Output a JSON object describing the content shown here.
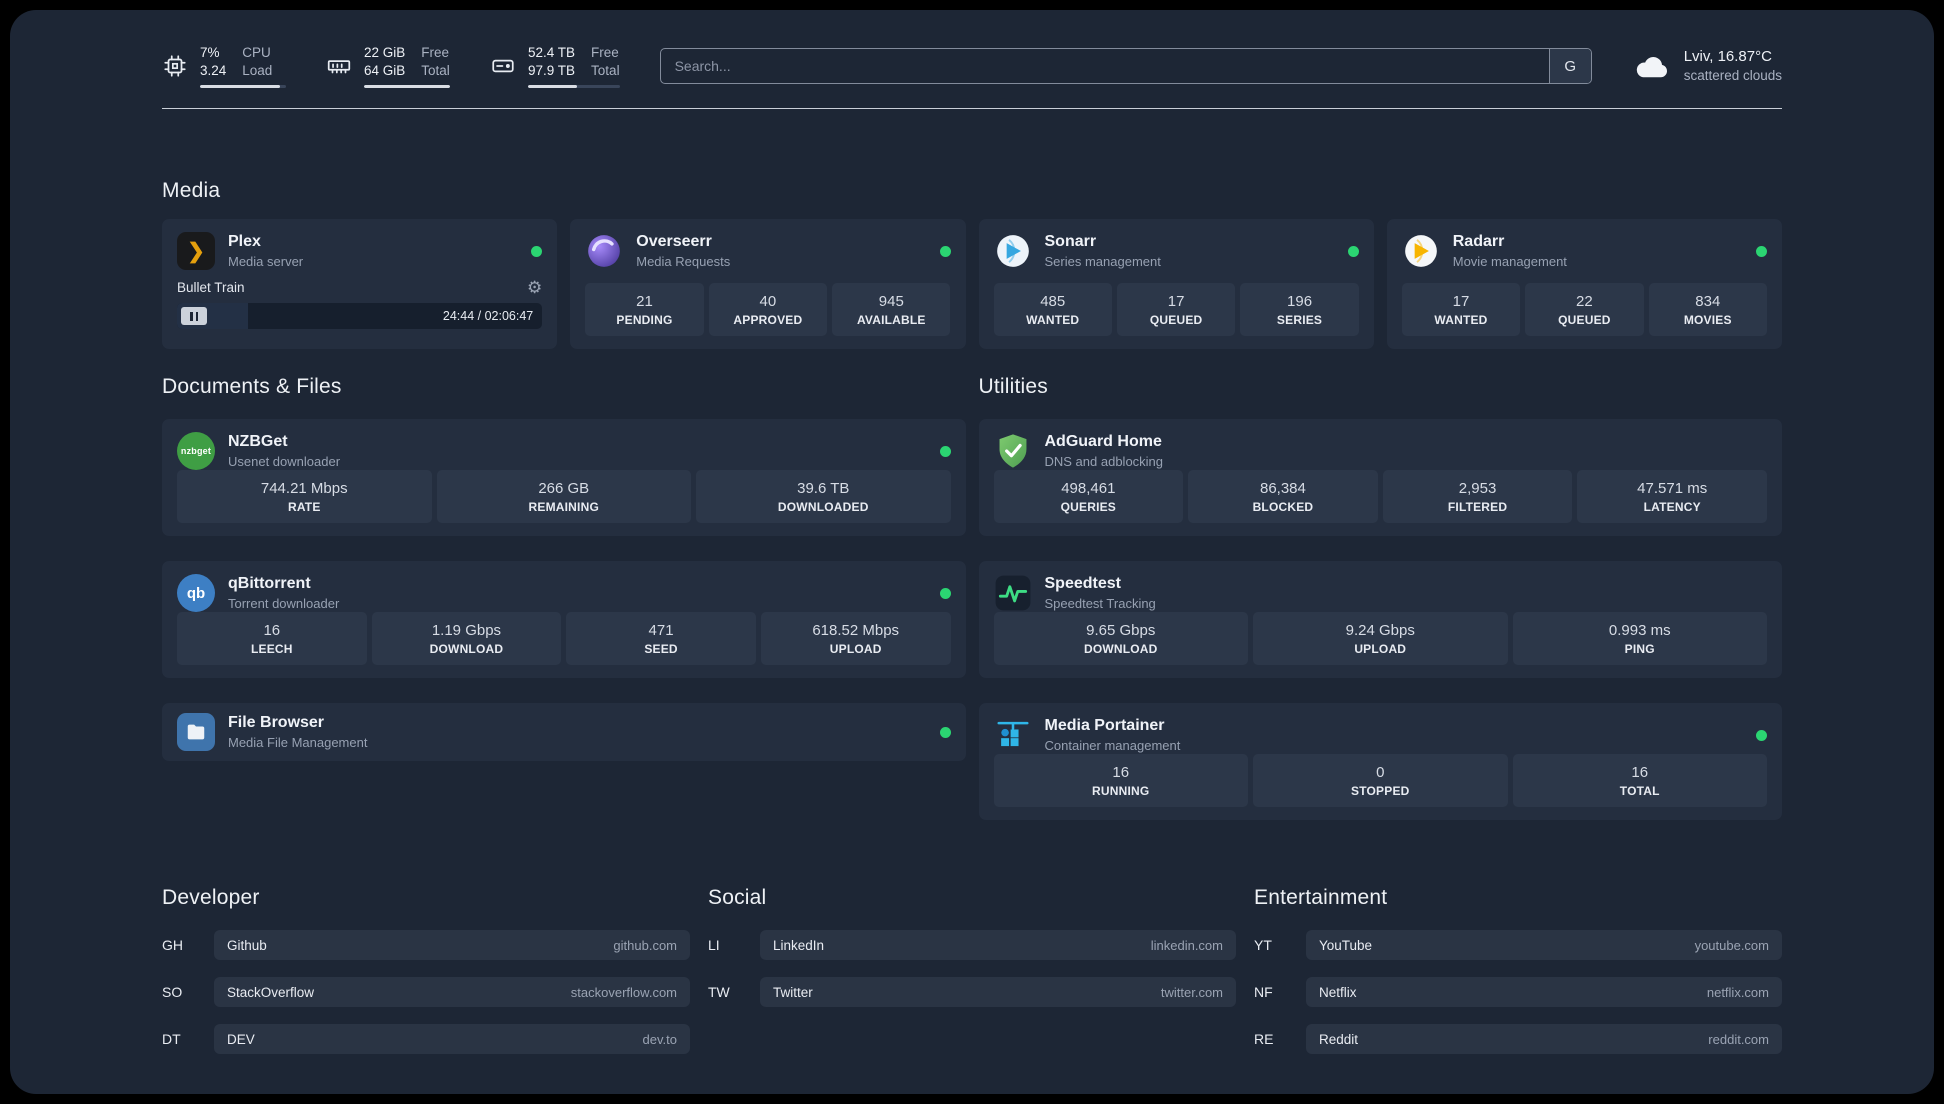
{
  "topbar": {
    "cpu": {
      "value_top": "7%",
      "value_bottom": "3.24",
      "label_top": "CPU",
      "label_bottom": "Load",
      "bar_percent": 93
    },
    "memory": {
      "value_top": "22 GiB",
      "value_bottom": "64 GiB",
      "label_top": "Free",
      "label_bottom": "Total",
      "bar_percent": 100
    },
    "disk": {
      "value_top": "52.4 TB",
      "value_bottom": "97.9 TB",
      "label_top": "Free",
      "label_bottom": "Total",
      "bar_percent": 54
    },
    "search": {
      "placeholder": "Search...",
      "button_label": "G"
    },
    "weather": {
      "location": "Lviv, 16.87°C",
      "condition": "scattered clouds"
    }
  },
  "sections": {
    "media": "Media",
    "documents": "Documents & Files",
    "utilities": "Utilities",
    "developer": "Developer",
    "social": "Social",
    "entertainment": "Entertainment"
  },
  "apps": {
    "plex": {
      "name": "Plex",
      "subtitle": "Media server",
      "now_playing": "Bullet Train",
      "time": "24:44 / 02:06:47",
      "progress_percent": 19.5
    },
    "overseerr": {
      "name": "Overseerr",
      "subtitle": "Media Requests",
      "stats": [
        {
          "value": "21",
          "label": "PENDING"
        },
        {
          "value": "40",
          "label": "APPROVED"
        },
        {
          "value": "945",
          "label": "AVAILABLE"
        }
      ]
    },
    "sonarr": {
      "name": "Sonarr",
      "subtitle": "Series management",
      "stats": [
        {
          "value": "485",
          "label": "WANTED"
        },
        {
          "value": "17",
          "label": "QUEUED"
        },
        {
          "value": "196",
          "label": "SERIES"
        }
      ]
    },
    "radarr": {
      "name": "Radarr",
      "subtitle": "Movie management",
      "stats": [
        {
          "value": "17",
          "label": "WANTED"
        },
        {
          "value": "22",
          "label": "QUEUED"
        },
        {
          "value": "834",
          "label": "MOVIES"
        }
      ]
    },
    "nzbget": {
      "name": "NZBGet",
      "subtitle": "Usenet downloader",
      "icon_text": "nzbget",
      "stats": [
        {
          "value": "744.21 Mbps",
          "label": "RATE"
        },
        {
          "value": "266 GB",
          "label": "REMAINING"
        },
        {
          "value": "39.6 TB",
          "label": "DOWNLOADED"
        }
      ]
    },
    "qbittorrent": {
      "name": "qBittorrent",
      "subtitle": "Torrent downloader",
      "icon_text": "qb",
      "stats": [
        {
          "value": "16",
          "label": "LEECH"
        },
        {
          "value": "1.19 Gbps",
          "label": "DOWNLOAD"
        },
        {
          "value": "471",
          "label": "SEED"
        },
        {
          "value": "618.52 Mbps",
          "label": "UPLOAD"
        }
      ]
    },
    "filebrowser": {
      "name": "File Browser",
      "subtitle": "Media File Management"
    },
    "adguard": {
      "name": "AdGuard Home",
      "subtitle": "DNS and adblocking",
      "stats": [
        {
          "value": "498,461",
          "label": "QUERIES"
        },
        {
          "value": "86,384",
          "label": "BLOCKED"
        },
        {
          "value": "2,953",
          "label": "FILTERED"
        },
        {
          "value": "47.571 ms",
          "label": "LATENCY"
        }
      ]
    },
    "speedtest": {
      "name": "Speedtest",
      "subtitle": "Speedtest Tracking",
      "stats": [
        {
          "value": "9.65 Gbps",
          "label": "DOWNLOAD"
        },
        {
          "value": "9.24 Gbps",
          "label": "UPLOAD"
        },
        {
          "value": "0.993 ms",
          "label": "PING"
        }
      ]
    },
    "portainer": {
      "name": "Media Portainer",
      "subtitle": "Container management",
      "stats": [
        {
          "value": "16",
          "label": "RUNNING"
        },
        {
          "value": "0",
          "label": "STOPPED"
        },
        {
          "value": "16",
          "label": "TOTAL"
        }
      ]
    }
  },
  "bookmarks": {
    "developer": [
      {
        "abbr": "GH",
        "name": "Github",
        "url": "github.com"
      },
      {
        "abbr": "SO",
        "name": "StackOverflow",
        "url": "stackoverflow.com"
      },
      {
        "abbr": "DT",
        "name": "DEV",
        "url": "dev.to"
      }
    ],
    "social": [
      {
        "abbr": "LI",
        "name": "LinkedIn",
        "url": "linkedin.com"
      },
      {
        "abbr": "TW",
        "name": "Twitter",
        "url": "twitter.com"
      }
    ],
    "entertainment": [
      {
        "abbr": "YT",
        "name": "YouTube",
        "url": "youtube.com"
      },
      {
        "abbr": "NF",
        "name": "Netflix",
        "url": "netflix.com"
      },
      {
        "abbr": "RE",
        "name": "Reddit",
        "url": "reddit.com"
      }
    ]
  },
  "colors": {
    "status_green": "#2bd572",
    "plex_amber": "#e5a00d"
  }
}
